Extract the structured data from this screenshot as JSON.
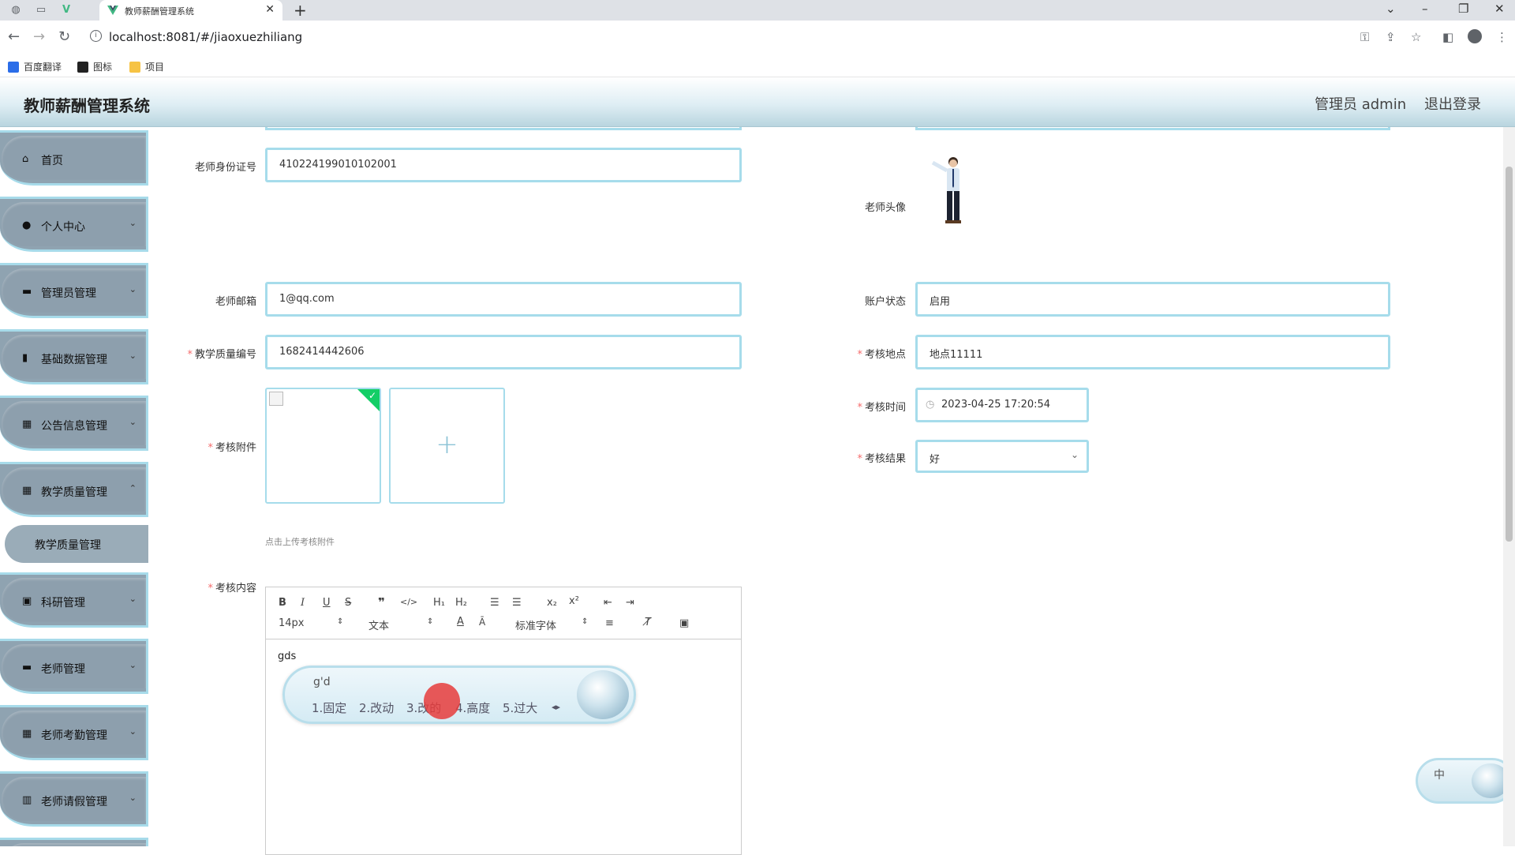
{
  "browser": {
    "tab_title": "教师薪酬管理系统",
    "url": "localhost:8081/#/jiaoxuezhiliang",
    "bookmarks": [
      "百度翻译",
      "图标",
      "项目"
    ]
  },
  "header": {
    "title": "教师薪酬管理系统",
    "user": "管理员 admin",
    "logout": "退出登录"
  },
  "sidebar": {
    "items": [
      {
        "label": "首页",
        "icon": "home-icon"
      },
      {
        "label": "个人中心",
        "icon": "user-icon"
      },
      {
        "label": "管理员管理",
        "icon": "briefcase-icon"
      },
      {
        "label": "基础数据管理",
        "icon": "building-icon"
      },
      {
        "label": "公告信息管理",
        "icon": "grid-icon"
      },
      {
        "label": "教学质量管理",
        "icon": "grid-icon"
      },
      {
        "label": "科研管理",
        "icon": "clipboard-icon"
      },
      {
        "label": "老师管理",
        "icon": "monitor-icon"
      },
      {
        "label": "老师考勤管理",
        "icon": "grid-icon"
      },
      {
        "label": "老师请假管理",
        "icon": "chart-icon"
      }
    ],
    "sub_item": "教学质量管理"
  },
  "form": {
    "id_label": "老师身份证号",
    "id_value": "410224199010102001",
    "avatar_label": "老师头像",
    "email_label": "老师邮箱",
    "email_value": "1@qq.com",
    "status_label": "账户状态",
    "status_value": "启用",
    "quality_no_label": "教学质量编号",
    "quality_no_value": "1682414442606",
    "location_label": "考核地点",
    "location_value": "地点11111",
    "attach_label": "考核附件",
    "attach_tip": "点击上传考核附件",
    "time_label": "考核时间",
    "time_value": "2023-04-25 17:20:54",
    "result_label": "考核结果",
    "result_value": "好",
    "content_label": "考核内容",
    "required_mark": "*"
  },
  "editor": {
    "font_size": "14px",
    "block_type": "文本",
    "font_family": "标准字体",
    "text": "gds"
  },
  "ime": {
    "composition": "g'd",
    "candidates": [
      "1.固定",
      "2.改动",
      "3.改的",
      "4.高度",
      "5.过大"
    ],
    "status": "中"
  }
}
